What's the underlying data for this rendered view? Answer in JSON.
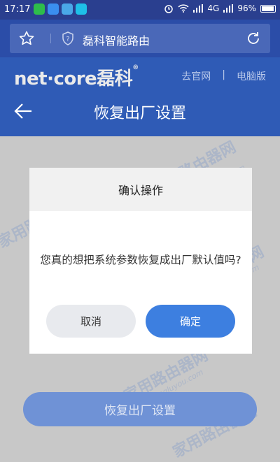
{
  "status": {
    "time": "17:17",
    "network": "4G",
    "battery": "96%"
  },
  "browser": {
    "title": "磊科智能路由",
    "icons": [
      "star-icon",
      "shield-icon",
      "reload-icon"
    ]
  },
  "header": {
    "logo_text": "net·core",
    "logo_cn": "磊科",
    "links": [
      "去官网",
      "电脑版"
    ],
    "link_separator": "|",
    "page_title": "恢复出厂设置"
  },
  "dialog": {
    "title": "确认操作",
    "message": "您真的想把系统参数恢复成出厂默认值吗?",
    "cancel_label": "取消",
    "ok_label": "确定"
  },
  "main_button": "恢复出厂设置",
  "watermark": {
    "text": "家用路由器网",
    "url": "www.jiayongluyou.com"
  },
  "colors": {
    "status_bar": "#2a3f8f",
    "header": "#2f5bb6",
    "overlay": "#c8c8c8",
    "ok_button": "#3d7fe0",
    "main_button": "#6f92d6"
  }
}
